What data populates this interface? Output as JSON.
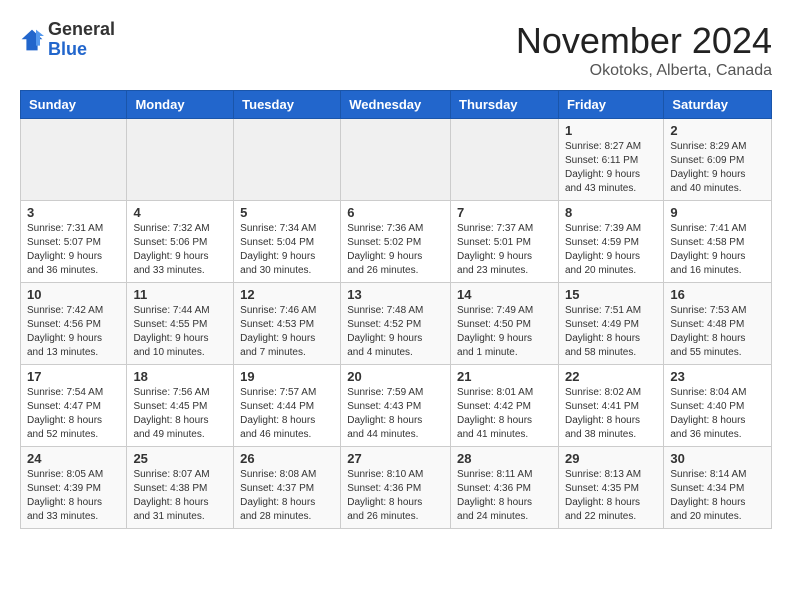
{
  "logo": {
    "general": "General",
    "blue": "Blue"
  },
  "title": {
    "month": "November 2024",
    "location": "Okotoks, Alberta, Canada"
  },
  "weekdays": [
    "Sunday",
    "Monday",
    "Tuesday",
    "Wednesday",
    "Thursday",
    "Friday",
    "Saturday"
  ],
  "weeks": [
    [
      {
        "day": "",
        "info": ""
      },
      {
        "day": "",
        "info": ""
      },
      {
        "day": "",
        "info": ""
      },
      {
        "day": "",
        "info": ""
      },
      {
        "day": "",
        "info": ""
      },
      {
        "day": "1",
        "info": "Sunrise: 8:27 AM\nSunset: 6:11 PM\nDaylight: 9 hours\nand 43 minutes."
      },
      {
        "day": "2",
        "info": "Sunrise: 8:29 AM\nSunset: 6:09 PM\nDaylight: 9 hours\nand 40 minutes."
      }
    ],
    [
      {
        "day": "3",
        "info": "Sunrise: 7:31 AM\nSunset: 5:07 PM\nDaylight: 9 hours\nand 36 minutes."
      },
      {
        "day": "4",
        "info": "Sunrise: 7:32 AM\nSunset: 5:06 PM\nDaylight: 9 hours\nand 33 minutes."
      },
      {
        "day": "5",
        "info": "Sunrise: 7:34 AM\nSunset: 5:04 PM\nDaylight: 9 hours\nand 30 minutes."
      },
      {
        "day": "6",
        "info": "Sunrise: 7:36 AM\nSunset: 5:02 PM\nDaylight: 9 hours\nand 26 minutes."
      },
      {
        "day": "7",
        "info": "Sunrise: 7:37 AM\nSunset: 5:01 PM\nDaylight: 9 hours\nand 23 minutes."
      },
      {
        "day": "8",
        "info": "Sunrise: 7:39 AM\nSunset: 4:59 PM\nDaylight: 9 hours\nand 20 minutes."
      },
      {
        "day": "9",
        "info": "Sunrise: 7:41 AM\nSunset: 4:58 PM\nDaylight: 9 hours\nand 16 minutes."
      }
    ],
    [
      {
        "day": "10",
        "info": "Sunrise: 7:42 AM\nSunset: 4:56 PM\nDaylight: 9 hours\nand 13 minutes."
      },
      {
        "day": "11",
        "info": "Sunrise: 7:44 AM\nSunset: 4:55 PM\nDaylight: 9 hours\nand 10 minutes."
      },
      {
        "day": "12",
        "info": "Sunrise: 7:46 AM\nSunset: 4:53 PM\nDaylight: 9 hours\nand 7 minutes."
      },
      {
        "day": "13",
        "info": "Sunrise: 7:48 AM\nSunset: 4:52 PM\nDaylight: 9 hours\nand 4 minutes."
      },
      {
        "day": "14",
        "info": "Sunrise: 7:49 AM\nSunset: 4:50 PM\nDaylight: 9 hours\nand 1 minute."
      },
      {
        "day": "15",
        "info": "Sunrise: 7:51 AM\nSunset: 4:49 PM\nDaylight: 8 hours\nand 58 minutes."
      },
      {
        "day": "16",
        "info": "Sunrise: 7:53 AM\nSunset: 4:48 PM\nDaylight: 8 hours\nand 55 minutes."
      }
    ],
    [
      {
        "day": "17",
        "info": "Sunrise: 7:54 AM\nSunset: 4:47 PM\nDaylight: 8 hours\nand 52 minutes."
      },
      {
        "day": "18",
        "info": "Sunrise: 7:56 AM\nSunset: 4:45 PM\nDaylight: 8 hours\nand 49 minutes."
      },
      {
        "day": "19",
        "info": "Sunrise: 7:57 AM\nSunset: 4:44 PM\nDaylight: 8 hours\nand 46 minutes."
      },
      {
        "day": "20",
        "info": "Sunrise: 7:59 AM\nSunset: 4:43 PM\nDaylight: 8 hours\nand 44 minutes."
      },
      {
        "day": "21",
        "info": "Sunrise: 8:01 AM\nSunset: 4:42 PM\nDaylight: 8 hours\nand 41 minutes."
      },
      {
        "day": "22",
        "info": "Sunrise: 8:02 AM\nSunset: 4:41 PM\nDaylight: 8 hours\nand 38 minutes."
      },
      {
        "day": "23",
        "info": "Sunrise: 8:04 AM\nSunset: 4:40 PM\nDaylight: 8 hours\nand 36 minutes."
      }
    ],
    [
      {
        "day": "24",
        "info": "Sunrise: 8:05 AM\nSunset: 4:39 PM\nDaylight: 8 hours\nand 33 minutes."
      },
      {
        "day": "25",
        "info": "Sunrise: 8:07 AM\nSunset: 4:38 PM\nDaylight: 8 hours\nand 31 minutes."
      },
      {
        "day": "26",
        "info": "Sunrise: 8:08 AM\nSunset: 4:37 PM\nDaylight: 8 hours\nand 28 minutes."
      },
      {
        "day": "27",
        "info": "Sunrise: 8:10 AM\nSunset: 4:36 PM\nDaylight: 8 hours\nand 26 minutes."
      },
      {
        "day": "28",
        "info": "Sunrise: 8:11 AM\nSunset: 4:36 PM\nDaylight: 8 hours\nand 24 minutes."
      },
      {
        "day": "29",
        "info": "Sunrise: 8:13 AM\nSunset: 4:35 PM\nDaylight: 8 hours\nand 22 minutes."
      },
      {
        "day": "30",
        "info": "Sunrise: 8:14 AM\nSunset: 4:34 PM\nDaylight: 8 hours\nand 20 minutes."
      }
    ]
  ]
}
